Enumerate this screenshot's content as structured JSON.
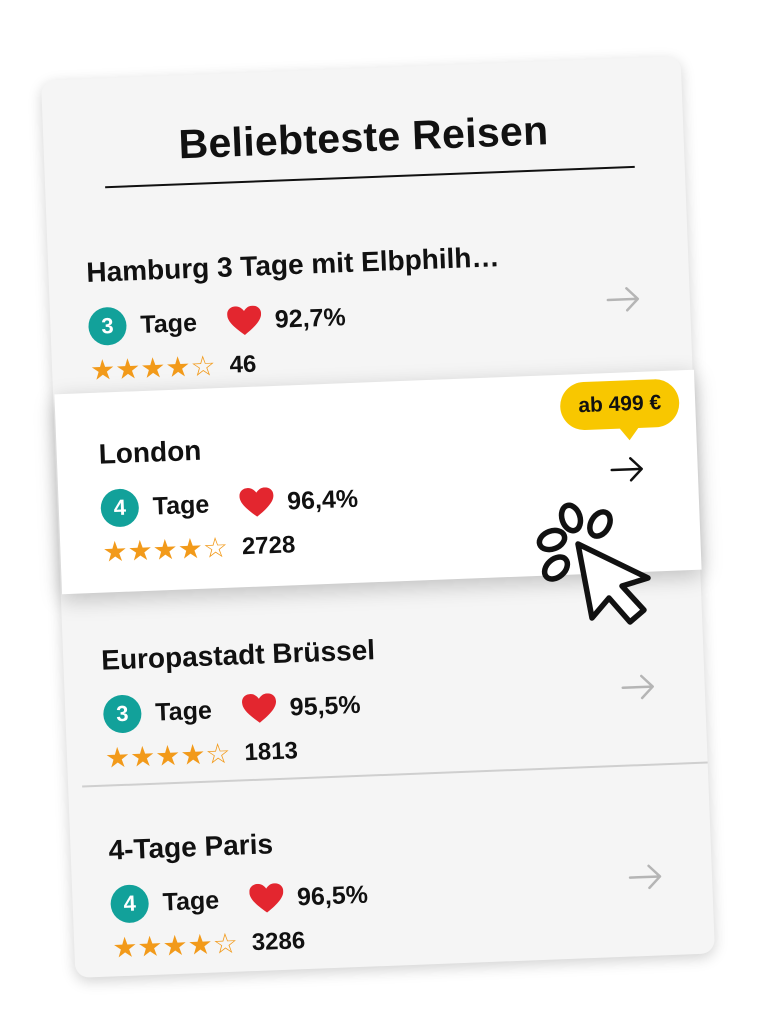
{
  "title": "Beliebteste Reisen",
  "trips": [
    {
      "name": "Hamburg 3 Tage mit Elbphilh…",
      "days": "3",
      "days_label": "Tage",
      "rating_percent": "92,7%",
      "stars": 4,
      "review_count": "46"
    },
    {
      "name": "London",
      "days": "4",
      "days_label": "Tage",
      "rating_percent": "96,4%",
      "stars": 4,
      "review_count": "2728",
      "price_label": "ab 499 €",
      "highlighted": true
    },
    {
      "name": "Europastadt Brüssel",
      "days": "3",
      "days_label": "Tage",
      "rating_percent": "95,5%",
      "stars": 4,
      "review_count": "1813"
    },
    {
      "name": "4-Tage Paris",
      "days": "4",
      "days_label": "Tage",
      "rating_percent": "96,5%",
      "stars": 4,
      "review_count": "3286"
    }
  ],
  "icons": {
    "heart": "heart-icon",
    "star": "star-icon",
    "arrow": "arrow-right-icon",
    "cursor": "pointer-cursor-icon"
  },
  "colors": {
    "badge": "#12a19a",
    "heart": "#e3262f",
    "star": "#f29a1a",
    "price_bubble": "#f8c700",
    "card_bg": "#f5f5f5"
  }
}
